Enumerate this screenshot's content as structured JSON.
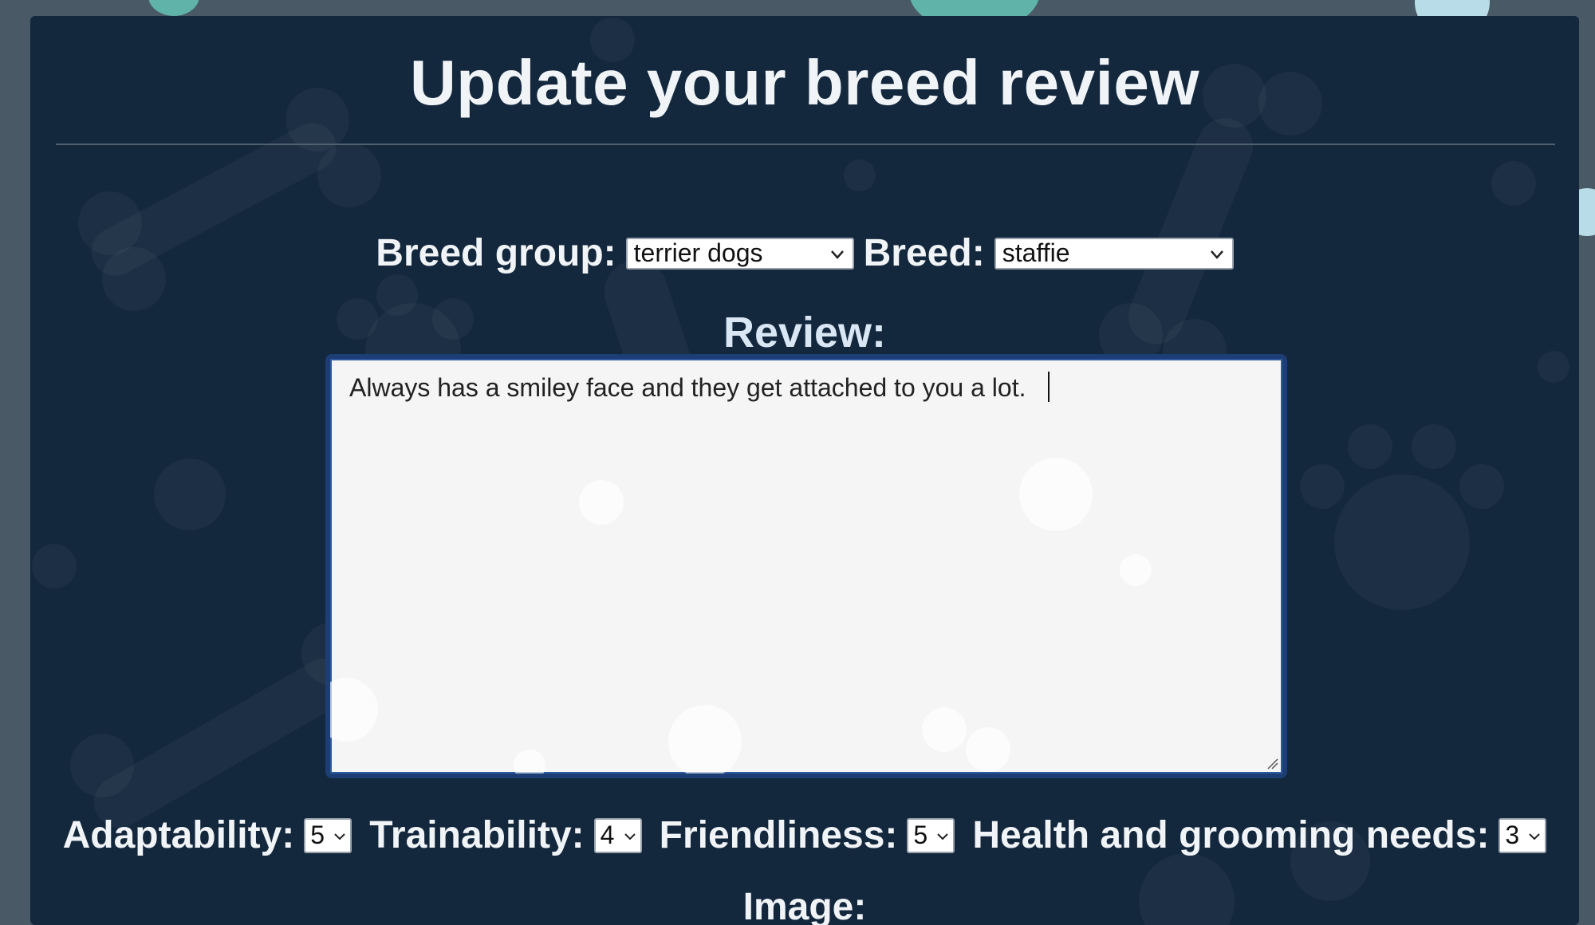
{
  "page": {
    "title": "Update your breed review"
  },
  "form": {
    "breed_group_label": "Breed group:",
    "breed_group_value": "terrier dogs",
    "breed_label": "Breed:",
    "breed_value": "staffie",
    "review_label": "Review:",
    "review_text": "Always has a smiley face and they get attached to you a lot.",
    "ratings": [
      {
        "label": "Adaptability:",
        "value": "5"
      },
      {
        "label": "Trainability:",
        "value": "4"
      },
      {
        "label": "Friendliness:",
        "value": "5"
      },
      {
        "label": "Health and grooming needs:",
        "value": "3"
      }
    ],
    "image_label": "Image:"
  },
  "icons": {
    "dropdown": "chevron-down-icon",
    "resize": "resize-grip-icon"
  },
  "colors": {
    "page_background": "#4a5966",
    "card_background": "#13273d",
    "heading_text": "#f1f4f7",
    "textarea_border": "#1d3e74",
    "teal_accent": "#5fb3a8",
    "light_blue_accent": "#b9dde8"
  }
}
